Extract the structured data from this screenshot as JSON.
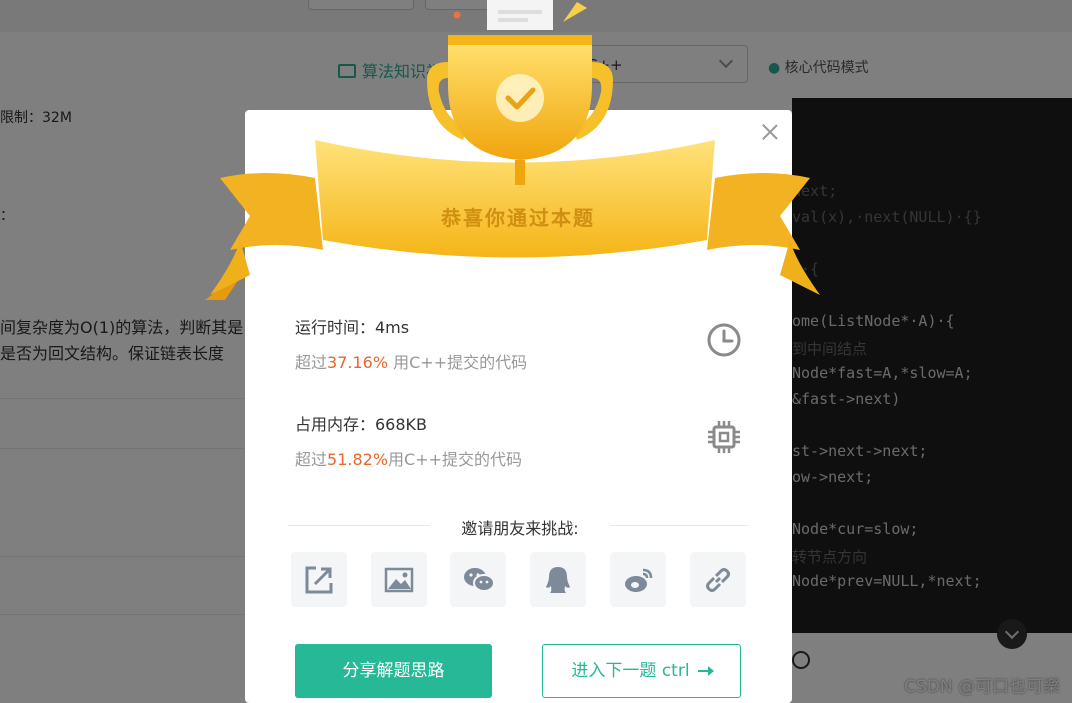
{
  "background": {
    "algo_link": "算法知识视",
    "language": "C++",
    "mode": "核心代码模式",
    "limit": "限制：32M",
    "bullet": "：",
    "desc_line1": "间复杂度为O(1)的算法，判断其是",
    "desc_line2": "是否为回文结构。保证链表长度",
    "code_lines": [
      {
        "text": "next;",
        "dim": true
      },
      {
        "text": "val(x),·next(NULL)·{}",
        "dim": true
      },
      {
        "text": "t·{",
        "dim": true
      },
      {
        "text": "ome(ListNode*·A)·{",
        "dim": false
      },
      {
        "text": "到中间结点",
        "dim": true
      },
      {
        "text": "Node*fast=A,*slow=A;",
        "dim": false
      },
      {
        "text": "&fast->next)",
        "dim": false
      },
      {
        "text": "st->next->next;",
        "dim": false
      },
      {
        "text": "ow->next;",
        "dim": false
      },
      {
        "text": "Node*cur=slow;",
        "dim": false
      },
      {
        "text": "转节点方向",
        "dim": true
      },
      {
        "text": "Node*prev=NULL,*next;",
        "dim": false
      }
    ],
    "watermark": "CSDN @可口也可樂"
  },
  "modal": {
    "title": "恭喜你通过本题",
    "runtime_label": "运行时间：4ms",
    "runtime_prefix": "超过",
    "runtime_pct": "37.16%",
    "runtime_suffix": " 用C++提交的代码",
    "memory_label": "占用内存：668KB",
    "memory_prefix": "超过",
    "memory_pct": "51.82%",
    "memory_suffix": "用C++提交的代码",
    "invite": "邀请朋友来挑战:",
    "share_btn": "分享解题思路",
    "next_btn": "进入下一题 ctrl",
    "share_icons": [
      "external-share-icon",
      "image-icon",
      "wechat-icon",
      "qq-icon",
      "weibo-icon",
      "link-icon"
    ],
    "accent_color": "#26b897",
    "highlight_color": "#e8652f"
  }
}
